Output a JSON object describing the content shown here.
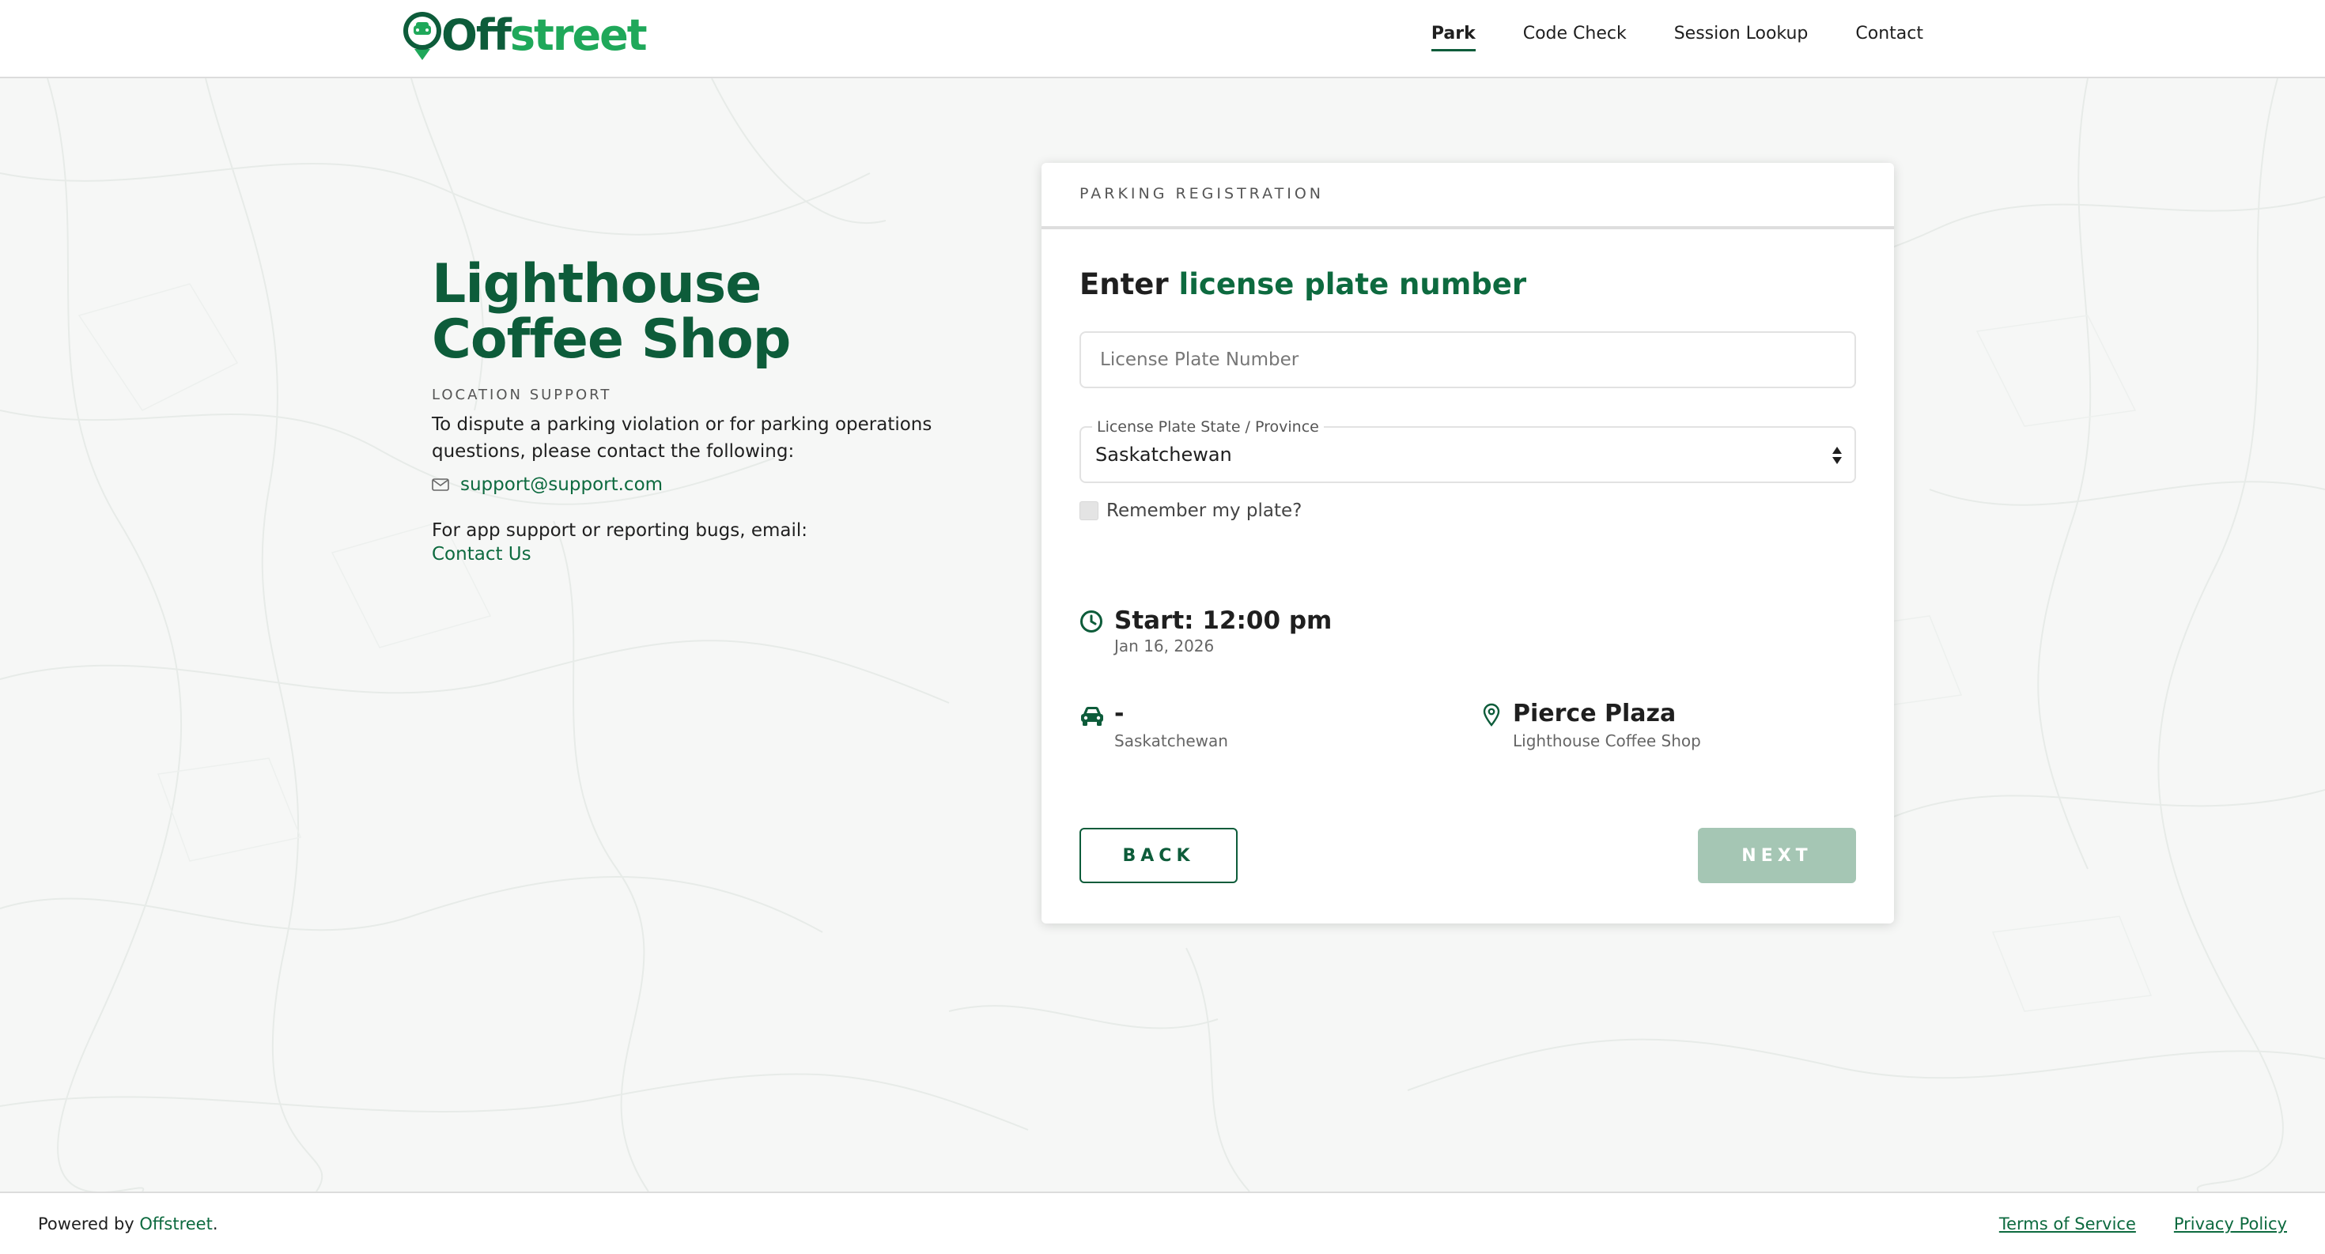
{
  "header": {
    "logo": {
      "part1": "Off",
      "part2": "street"
    },
    "nav": [
      {
        "label": "Park",
        "active": true
      },
      {
        "label": "Code Check",
        "active": false
      },
      {
        "label": "Session Lookup",
        "active": false
      },
      {
        "label": "Contact",
        "active": false
      }
    ]
  },
  "info": {
    "title": "Lighthouse Coffee Shop",
    "support_label": "LOCATION SUPPORT",
    "support_text": "To dispute a parking violation or for parking operations questions, please contact the following:",
    "email": "support@support.com",
    "app_support": "For app support or reporting bugs, email:",
    "contact_link": "Contact Us"
  },
  "card": {
    "header": "PARKING REGISTRATION",
    "heading_prefix": "Enter ",
    "heading_highlight": "license plate number",
    "plate_placeholder": "License Plate Number",
    "plate_value": "",
    "state_label": "License Plate State / Province",
    "state_value": "Saskatchewan",
    "remember_label": "Remember my plate?",
    "start_title": "Start: 12:00 pm",
    "start_date": "Jan 16, 2026",
    "plate_display": "-",
    "plate_region": "Saskatchewan",
    "location_title": "Pierce Plaza",
    "location_sub": "Lighthouse Coffee Shop",
    "back_label": "BACK",
    "next_label": "NEXT"
  },
  "footer": {
    "powered_prefix": "Powered by ",
    "powered_link": "Offstreet",
    "powered_suffix": ".",
    "terms": "Terms of Service",
    "privacy": "Privacy Policy"
  },
  "colors": {
    "brand_dark": "#0d5c3a",
    "brand_light": "#1fa85a",
    "next_disabled": "#a5c6b4"
  },
  "icons": {
    "logo": "map-pin-car-icon",
    "email": "envelope-icon",
    "start": "clock-icon",
    "vehicle": "car-icon",
    "location": "map-pin-icon",
    "select": "sort-arrows-icon"
  }
}
